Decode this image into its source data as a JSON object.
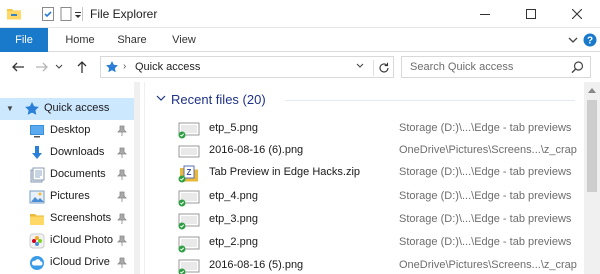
{
  "window": {
    "title": "File Explorer"
  },
  "ribbon": {
    "tabs": [
      {
        "label": "File"
      },
      {
        "label": "Home"
      },
      {
        "label": "Share"
      },
      {
        "label": "View"
      }
    ]
  },
  "address": {
    "location": "Quick access"
  },
  "search": {
    "placeholder": "Search Quick access"
  },
  "nav_pane": {
    "items": [
      {
        "label": "Quick access",
        "icon": "star-icon"
      },
      {
        "label": "Desktop",
        "icon": "desktop-icon"
      },
      {
        "label": "Downloads",
        "icon": "download-icon"
      },
      {
        "label": "Documents",
        "icon": "documents-icon"
      },
      {
        "label": "Pictures",
        "icon": "pictures-icon"
      },
      {
        "label": "Screenshots",
        "icon": "folder-icon"
      },
      {
        "label": "iCloud Photo",
        "icon": "icloud-photo-icon"
      },
      {
        "label": "iCloud Drive",
        "icon": "icloud-drive-icon"
      }
    ]
  },
  "recent": {
    "header": "Recent files (20)",
    "files": [
      {
        "name": "etp_5.png",
        "path": "Storage (D:)\\...\\Edge - tab previews",
        "icon": "image-file-icon"
      },
      {
        "name": "2016-08-16 (6).png",
        "path": "OneDrive\\Pictures\\Screens...\\z_crap",
        "icon": "image-file-icon"
      },
      {
        "name": "Tab Preview in Edge Hacks.zip",
        "path": "Storage (D:)\\...\\Edge - tab previews",
        "icon": "zip-file-icon"
      },
      {
        "name": "etp_4.png",
        "path": "Storage (D:)\\...\\Edge - tab previews",
        "icon": "image-file-icon"
      },
      {
        "name": "etp_3.png",
        "path": "Storage (D:)\\...\\Edge - tab previews",
        "icon": "image-file-icon"
      },
      {
        "name": "etp_2.png",
        "path": "Storage (D:)\\...\\Edge - tab previews",
        "icon": "image-file-icon"
      },
      {
        "name": "2016-08-16 (5).png",
        "path": "OneDrive\\Pictures\\Screens...\\z_crap",
        "icon": "image-file-icon"
      }
    ]
  },
  "colors": {
    "file_tab": "#1979ca",
    "selection": "#cce8ff",
    "group_header": "#1e3287"
  }
}
